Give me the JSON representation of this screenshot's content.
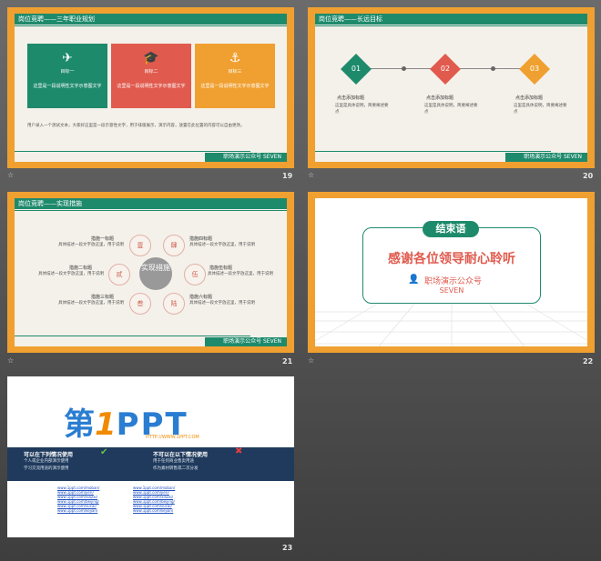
{
  "slide19": {
    "header": "岗位竞聘——三年职业规划",
    "goals": [
      {
        "icon": "paper-plane-icon",
        "title": "目标一",
        "desc": "这里是一段说明性文字示意图文字",
        "color": "#1e8a6c"
      },
      {
        "icon": "graduation-cap-icon",
        "title": "目标二",
        "desc": "这里是一段说明性文字示意图文字",
        "color": "#e05a4e"
      },
      {
        "icon": "anchor-icon",
        "title": "目标三",
        "desc": "这里是一段说明性文字示意图文字",
        "color": "#f0a030"
      }
    ],
    "para": "用户录入一个测试文本，大家好这里是一段示意性文字，用于排版展示，演示内容，放置在此位置的内容可以自由更改。",
    "footer": "职场演示公众号 SEVEN",
    "number": "19"
  },
  "slide20": {
    "header": "岗位竞聘——长远目标",
    "steps": [
      {
        "n": "01",
        "color": "#1e8a6c",
        "title": "点击添加标题",
        "desc": "这里是具体说明，简要阐述要点"
      },
      {
        "n": "02",
        "color": "#e05a4e",
        "title": "点击添加标题",
        "desc": "这里是具体说明，简要阐述要点"
      },
      {
        "n": "03",
        "color": "#f0a030",
        "title": "点击添加标题",
        "desc": "这里是具体说明，简要阐述要点"
      }
    ],
    "footer": "职场演示公众号 SEVEN",
    "number": "20"
  },
  "slide21": {
    "header": "岗位竞聘——实现措施",
    "center": "实现措施",
    "items": [
      {
        "c": "壹",
        "t": "措施一标题",
        "d": "具体描述一段文字放这里，用于说明"
      },
      {
        "c": "贰",
        "t": "措施二标题",
        "d": "具体描述一段文字放这里，用于说明"
      },
      {
        "c": "叁",
        "t": "措施三标题",
        "d": "具体描述一段文字放这里，用于说明"
      },
      {
        "c": "肆",
        "t": "措施四标题",
        "d": "具体描述一段文字放这里，用于说明"
      },
      {
        "c": "伍",
        "t": "措施伍标题",
        "d": "具体描述一段文字放这里，用于说明"
      },
      {
        "c": "陆",
        "t": "措施六标题",
        "d": "具体描述一段文字放这里，用于说明"
      }
    ],
    "footer": "职场演示公众号 SEVEN",
    "number": "21"
  },
  "slide22": {
    "tag": "结束语",
    "title": "感谢各位领导耐心聆听",
    "sub": "职场演示公众号",
    "sub2": "SEVEN",
    "number": "22"
  },
  "slide23": {
    "logo_a": "第",
    "logo_b": "1",
    "logo_c": "PPT",
    "logo_url": "HTTP://WWW.1PPT.COM",
    "can_title": "可以在下列情况使用",
    "cannot_title": "不可以在以下情况使用",
    "can_lines": [
      "个人或企业内部演示使用",
      "学习交流用途的演示使用"
    ],
    "cannot_lines": [
      "用于任何商业售卖用途",
      "作为素材转售或二次分发"
    ],
    "links": [
      "www.1ppt.com/moban/",
      "www.1ppt.com/jieri/",
      "www.1ppt.com/xiazai/",
      "www.1ppt.com/beijing/",
      "www.1ppt.com/sucai/",
      "www.1ppt.com/kejian/"
    ],
    "number": "23"
  }
}
